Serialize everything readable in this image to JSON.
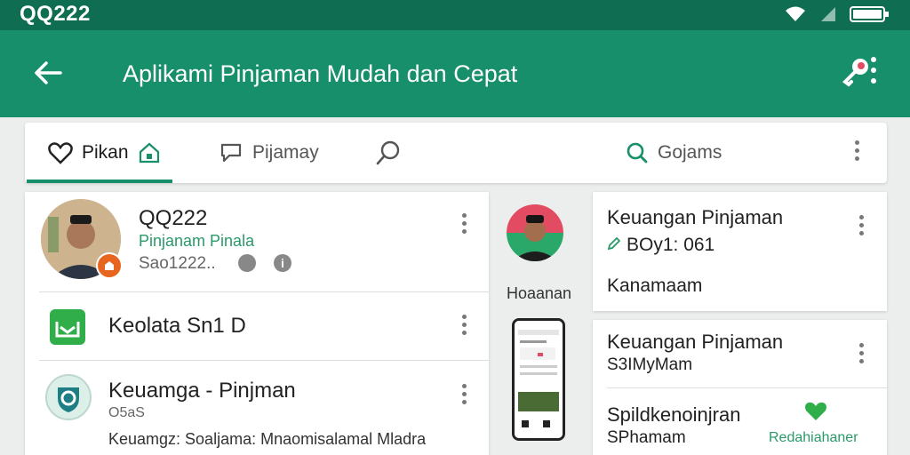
{
  "status_bar": {
    "carrier": "QQ222"
  },
  "app_bar": {
    "title": "Aplikami Pinjaman Mudah dan Cepat"
  },
  "tabs": [
    {
      "label": "Pikan"
    },
    {
      "label": "Pijamay"
    },
    {
      "label": ""
    },
    {
      "label": "Gojams"
    }
  ],
  "list": {
    "profile": {
      "name": "QQ222",
      "subtitle": "Pinjanam Pinala",
      "meta": "Sao1222.."
    },
    "item2": {
      "title": "Keolata Sn1 D"
    },
    "item3": {
      "title": "Keuamga - Pinjman",
      "code": "O5aS",
      "desc": "Keuamgz: Soaljama: Mnaomisalamal Mladra"
    }
  },
  "middle": {
    "label": "Hoaanan"
  },
  "cards": [
    {
      "title": "Keuangan Pinjaman",
      "amount": "BOy1: 061",
      "meta": "Kanamaam"
    },
    {
      "title": "Keuangan Pinjaman",
      "sub": "S3IMyMam"
    },
    {
      "title": "Spildkenoinjran",
      "sub": "SPhamam",
      "right_label": "Redahiahaner"
    }
  ],
  "colors": {
    "primary": "#178f6a",
    "status": "#0f6e52",
    "accent": "#e34b63",
    "badge": "#e8651f"
  }
}
